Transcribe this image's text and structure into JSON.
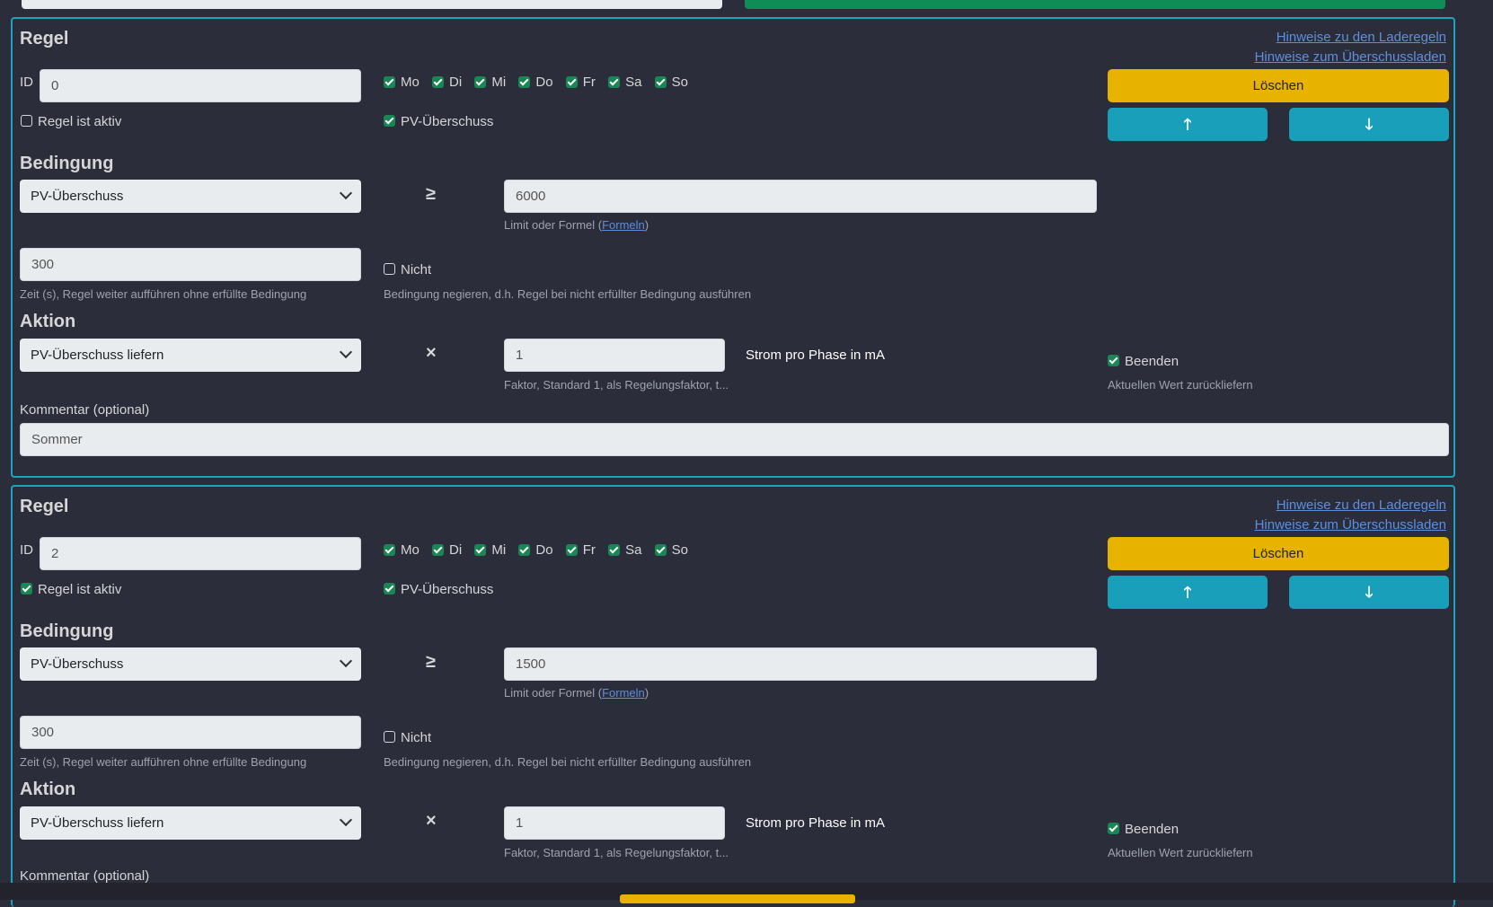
{
  "rules": [
    {
      "title": "Regel",
      "link_hints_charge": "Hinweise zu den Laderegeln",
      "link_hints_surplus": "Hinweise zum Überschussladen",
      "id_label": "ID",
      "id_value": "0",
      "days": [
        {
          "label": "Mo",
          "checked": true
        },
        {
          "label": "Di",
          "checked": true
        },
        {
          "label": "Mi",
          "checked": true
        },
        {
          "label": "Do",
          "checked": true
        },
        {
          "label": "Fr",
          "checked": true
        },
        {
          "label": "Sa",
          "checked": true
        },
        {
          "label": "So",
          "checked": true
        }
      ],
      "delete_label": "Löschen",
      "active_label": "Regel ist aktiv",
      "active_checked": false,
      "pv_label": "PV-Überschuss",
      "pv_checked": true,
      "condition_heading": "Bedingung",
      "condition_select": "PV-Überschuss",
      "operator": "≥",
      "limit_value": "6000",
      "limit_help_prefix": "Limit oder Formel (",
      "limit_help_link": "Formeln",
      "limit_help_suffix": ")",
      "time_value": "300",
      "time_help": "Zeit (s), Regel weiter aufführen ohne erfüllte Bedingung",
      "not_label": "Nicht",
      "not_checked": false,
      "not_help": "Bedingung negieren, d.h. Regel bei nicht erfüllter Bedingung ausführen",
      "action_heading": "Aktion",
      "action_select": "PV-Überschuss liefern",
      "action_operator": "×",
      "factor_value": "1",
      "factor_help": "Faktor, Standard 1, als Regelungsfaktor, t...",
      "unit_label": "Strom pro Phase in mA",
      "end_label": "Beenden",
      "end_checked": true,
      "end_help": "Aktuellen Wert zurückliefern",
      "comment_label": "Kommentar (optional)",
      "comment_value": "Sommer"
    },
    {
      "title": "Regel",
      "link_hints_charge": "Hinweise zu den Laderegeln",
      "link_hints_surplus": "Hinweise zum Überschussladen",
      "id_label": "ID",
      "id_value": "2",
      "days": [
        {
          "label": "Mo",
          "checked": true
        },
        {
          "label": "Di",
          "checked": true
        },
        {
          "label": "Mi",
          "checked": true
        },
        {
          "label": "Do",
          "checked": true
        },
        {
          "label": "Fr",
          "checked": true
        },
        {
          "label": "Sa",
          "checked": true
        },
        {
          "label": "So",
          "checked": true
        }
      ],
      "delete_label": "Löschen",
      "active_label": "Regel ist aktiv",
      "active_checked": true,
      "pv_label": "PV-Überschuss",
      "pv_checked": true,
      "condition_heading": "Bedingung",
      "condition_select": "PV-Überschuss",
      "operator": "≥",
      "limit_value": "1500",
      "limit_help_prefix": "Limit oder Formel (",
      "limit_help_link": "Formeln",
      "limit_help_suffix": ")",
      "time_value": "300",
      "time_help": "Zeit (s), Regel weiter aufführen ohne erfüllte Bedingung",
      "not_label": "Nicht",
      "not_checked": false,
      "not_help": "Bedingung negieren, d.h. Regel bei nicht erfüllter Bedingung ausführen",
      "action_heading": "Aktion",
      "action_select": "PV-Überschuss liefern",
      "action_operator": "×",
      "factor_value": "1",
      "factor_help": "Faktor, Standard 1, als Regelungsfaktor, t...",
      "unit_label": "Strom pro Phase in mA",
      "end_label": "Beenden",
      "end_checked": true,
      "end_help": "Aktuellen Wert zurückliefern",
      "comment_label": "Kommentar (optional)",
      "comment_value": ""
    }
  ],
  "icons": {
    "up": "arrow-up-icon",
    "down": "arrow-down-icon",
    "chevron": "chevron-down-icon"
  },
  "colors": {
    "background": "#2b2d3a",
    "card_border": "#1ba6c0",
    "delete_button": "#e8b200",
    "move_button": "#1a9fbb",
    "checkbox_on": "#198754",
    "link": "#5d8fe0"
  }
}
